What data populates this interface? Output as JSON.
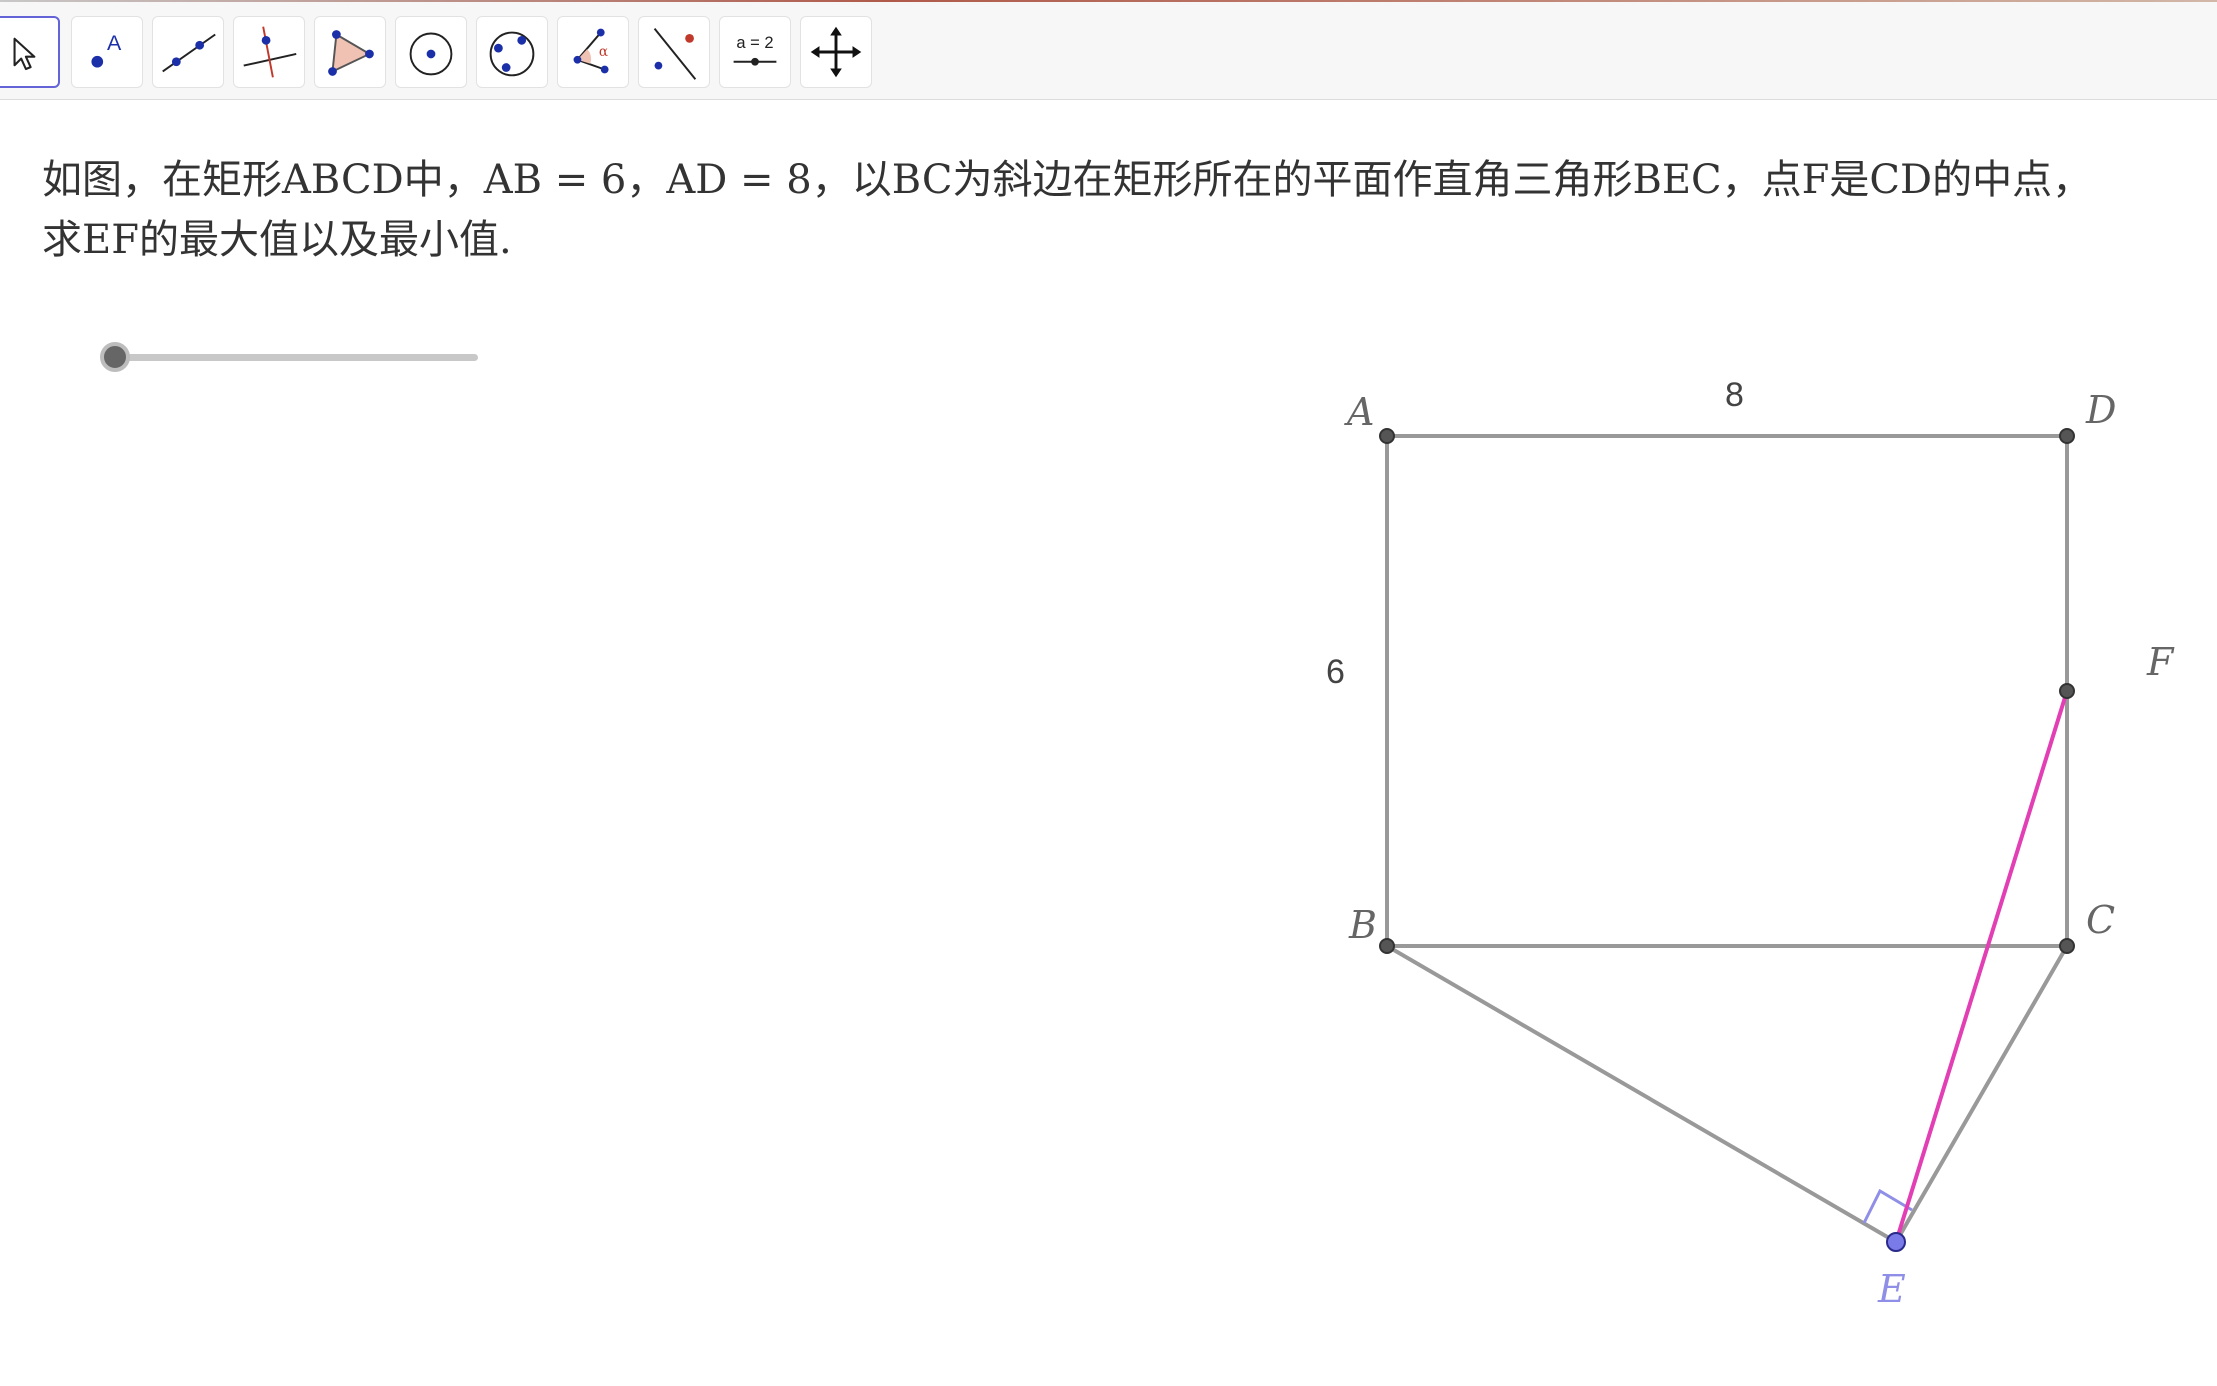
{
  "toolbar": {
    "tools": [
      {
        "icon": "move-arrow-icon"
      },
      {
        "icon": "point-icon",
        "glyph": "A"
      },
      {
        "icon": "line-icon"
      },
      {
        "icon": "perpendicular-line-icon"
      },
      {
        "icon": "polygon-icon"
      },
      {
        "icon": "circle-center-point-icon"
      },
      {
        "icon": "circle-three-points-icon"
      },
      {
        "icon": "angle-icon",
        "glyph": "α"
      },
      {
        "icon": "reflect-point-icon"
      },
      {
        "icon": "slider-icon",
        "glyph": "a = 2"
      },
      {
        "icon": "move-view-icon"
      }
    ]
  },
  "problem": {
    "line1": "如图，在矩形ABCD中，AB = 6，AD = 8，以BC为斜边在矩形所在的平面作直角三角形BEC，点F是CD的中点，",
    "line2": "求EF的最大值以及最小值."
  },
  "slider": {
    "value": 0
  },
  "figure": {
    "labels": {
      "A": "A",
      "B": "B",
      "C": "C",
      "D": "D",
      "E": "E",
      "F": "F"
    },
    "length_AD": "8",
    "length_AB": "6",
    "colors": {
      "rectangle": "#999999",
      "segment_EF": "#e23fb4",
      "point_E": "#7a7ae8",
      "point": "#555555",
      "right_angle_mark": "#8f8fe8",
      "label_E": "#8f8fe8"
    }
  }
}
